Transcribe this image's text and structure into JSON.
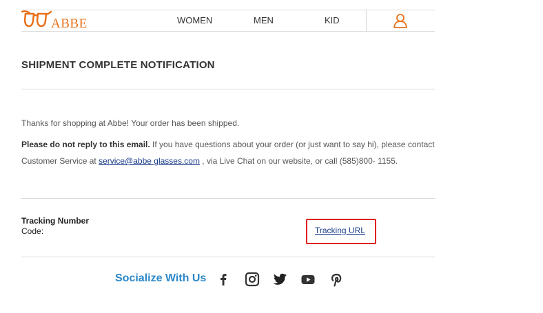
{
  "header": {
    "logo_text": "ABBE",
    "nav": [
      "WOMEN",
      "MEN",
      "KID"
    ]
  },
  "title": "SHIPMENT COMPLETE NOTIFICATION",
  "body": {
    "thanks": "Thanks for shopping at Abbe! Your order has been shipped.",
    "no_reply_bold": "Please do not reply to this email.",
    "no_reply_rest": " If you have questions about your order (or just want to say hi), please contact",
    "cs_prefix": "Customer Service at ",
    "email": "service@abbe glasses.com",
    "cs_suffix": " , via Live Chat on our website, or call (585)800- 1155."
  },
  "tracking": {
    "number_label": "Tracking Number",
    "code_label": "Code:",
    "url_label": "Tracking URL"
  },
  "social": {
    "title": "Socialize With Us",
    "icons": [
      "facebook-icon",
      "instagram-icon",
      "twitter-icon",
      "youtube-icon",
      "pinterest-icon"
    ]
  },
  "colors": {
    "brand": "#e8711a",
    "link": "#1a3c8a",
    "social_title": "#2b87c8",
    "highlight": "#e02020"
  }
}
